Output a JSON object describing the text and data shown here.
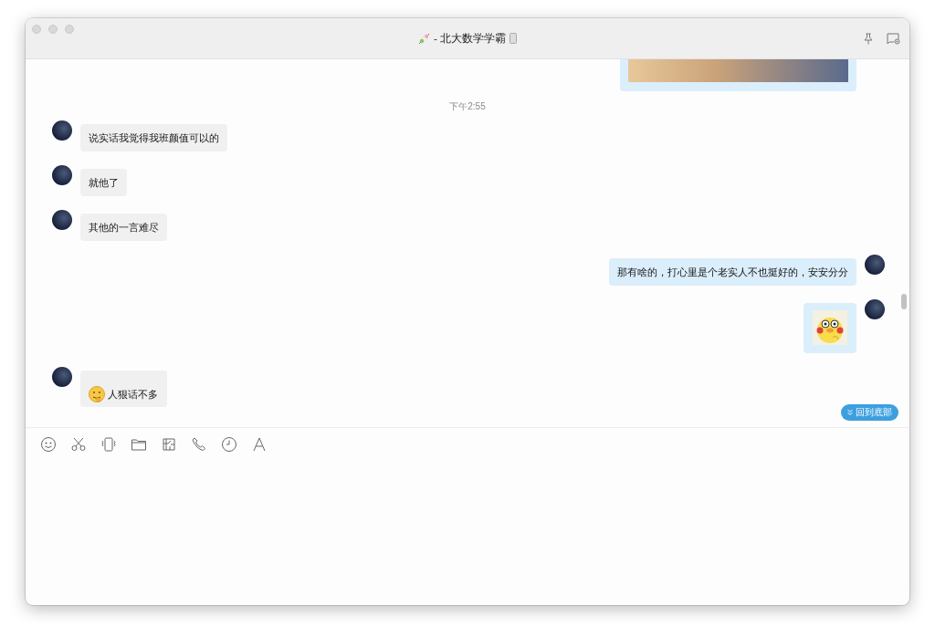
{
  "window": {
    "title": "- 北大数学学霸"
  },
  "messages": [
    {
      "kind": "image",
      "outgoing": true
    },
    {
      "kind": "time",
      "text": "下午2:55"
    },
    {
      "kind": "text",
      "outgoing": false,
      "text": "说实话我觉得我班颜值可以的"
    },
    {
      "kind": "text",
      "outgoing": false,
      "text": "就他了"
    },
    {
      "kind": "text",
      "outgoing": false,
      "text": "其他的一言难尽"
    },
    {
      "kind": "text",
      "outgoing": true,
      "text": "那有啥的，打心里是个老实人不也挺好的，安安分分"
    },
    {
      "kind": "sticker",
      "outgoing": true
    },
    {
      "kind": "emoji-text",
      "outgoing": false,
      "text": "人狠话不多"
    }
  ],
  "jump_button": {
    "label": "回到底部"
  }
}
